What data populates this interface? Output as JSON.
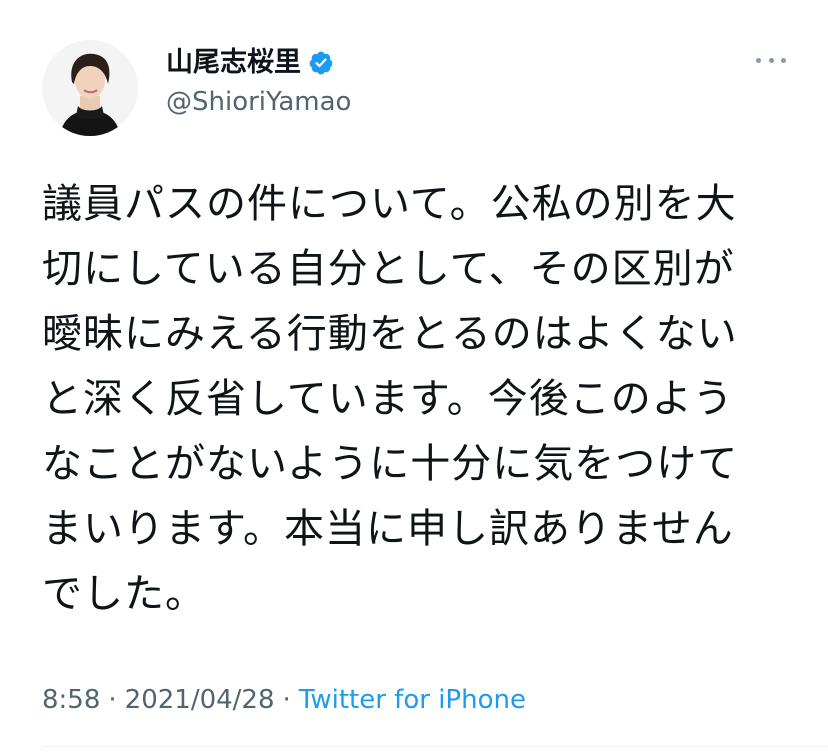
{
  "author": {
    "display_name": "山尾志桜里",
    "handle": "@ShioriYamao",
    "verified": true,
    "avatar_icon": "profile-photo",
    "verified_icon": "verified-badge-icon"
  },
  "tweet": {
    "text": "議員パスの件について。公私の別を大\n切にしている自分として、その区別が\n曖昧にみえる行動をとるのはよくない\nと深く反省しています。今後このよう\nなことがないように十分に気をつけて\nまいります。本当に申し訳ありません\nでした。"
  },
  "meta": {
    "time": "8:58",
    "separator": "·",
    "date": "2021/04/28",
    "source": "Twitter for iPhone"
  },
  "icons": {
    "more": "more-options-icon"
  },
  "colors": {
    "accent": "#1d9bf0",
    "secondary_text": "#536471",
    "primary_text": "#0f1419"
  }
}
